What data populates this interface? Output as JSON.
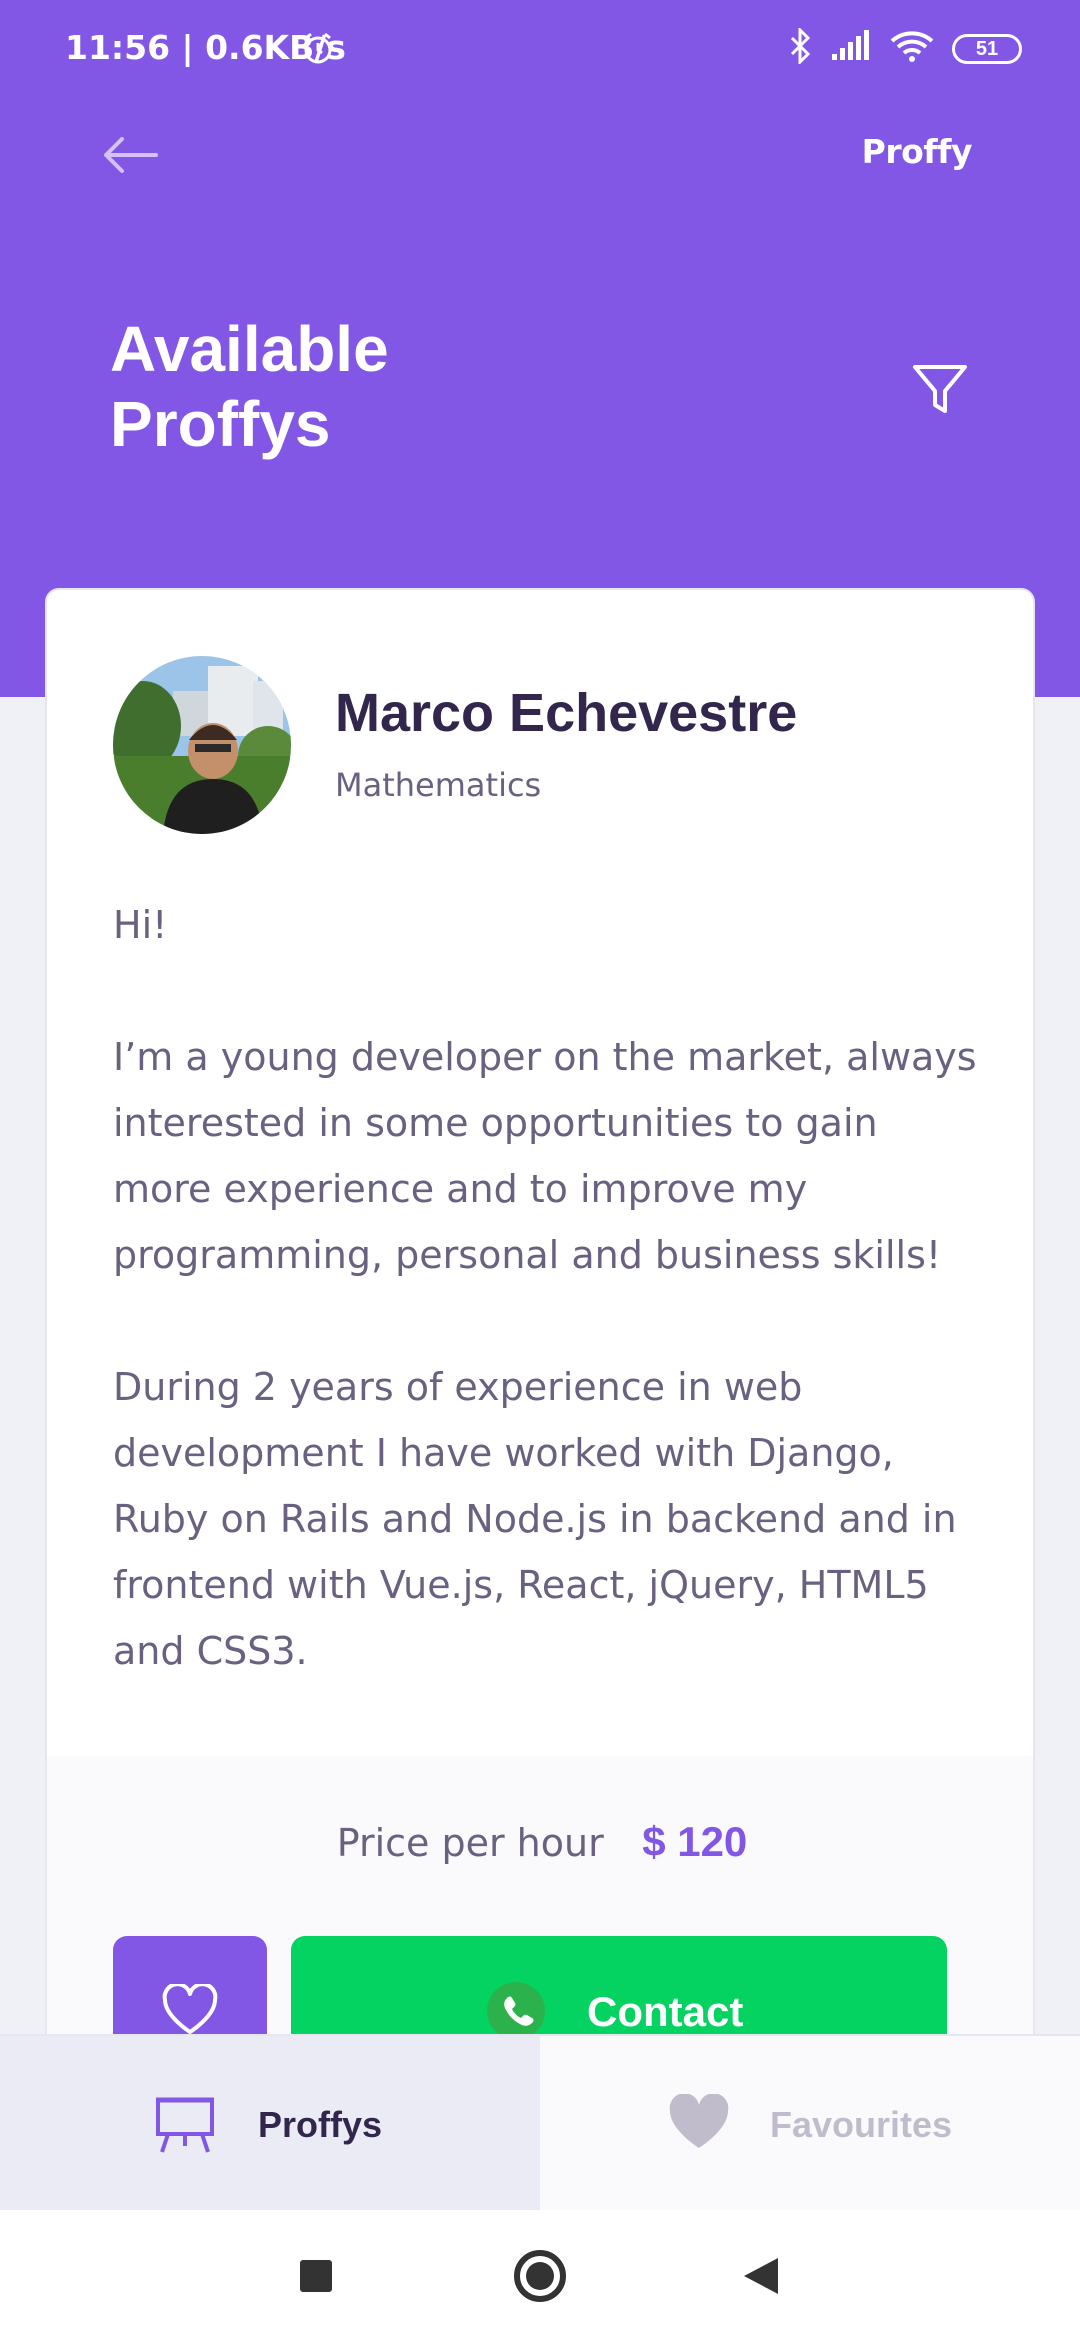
{
  "status_bar": {
    "time": "11:56 | 0.6KB/s",
    "battery": "51",
    "icons": [
      "alarm-icon",
      "bluetooth-icon",
      "signal-icon",
      "wifi-icon",
      "battery-icon"
    ]
  },
  "header": {
    "back_icon": "arrow-left-icon",
    "brand": "Proffy",
    "title_line1": "Available",
    "title_line2": "Proffys",
    "filter_icon": "filter-icon"
  },
  "teacher": {
    "name": "Marco Echevestre",
    "subject": "Mathematics",
    "bio": [
      "Hi!",
      "I’m a young developer on the market, always interested in some opportunities to gain more experience and to improve my programming, personal and business skills!",
      "During 2 years of experience in web development I have worked with Django, Ruby on Rails and Node.js in backend and in frontend with Vue.js, React, jQuery, HTML5 and CSS3."
    ],
    "price_label": "Price per hour",
    "price_value": "$ 120",
    "contact_label": "Contact"
  },
  "tabs": [
    {
      "label": "Proffys",
      "icon": "easel-icon",
      "active": true
    },
    {
      "label": "Favourites",
      "icon": "heart-icon",
      "active": false
    }
  ],
  "colors": {
    "primary": "#8257e5",
    "success": "#04d361",
    "title": "#32264d",
    "text": "#6a6180",
    "background": "#f0f0f7"
  }
}
